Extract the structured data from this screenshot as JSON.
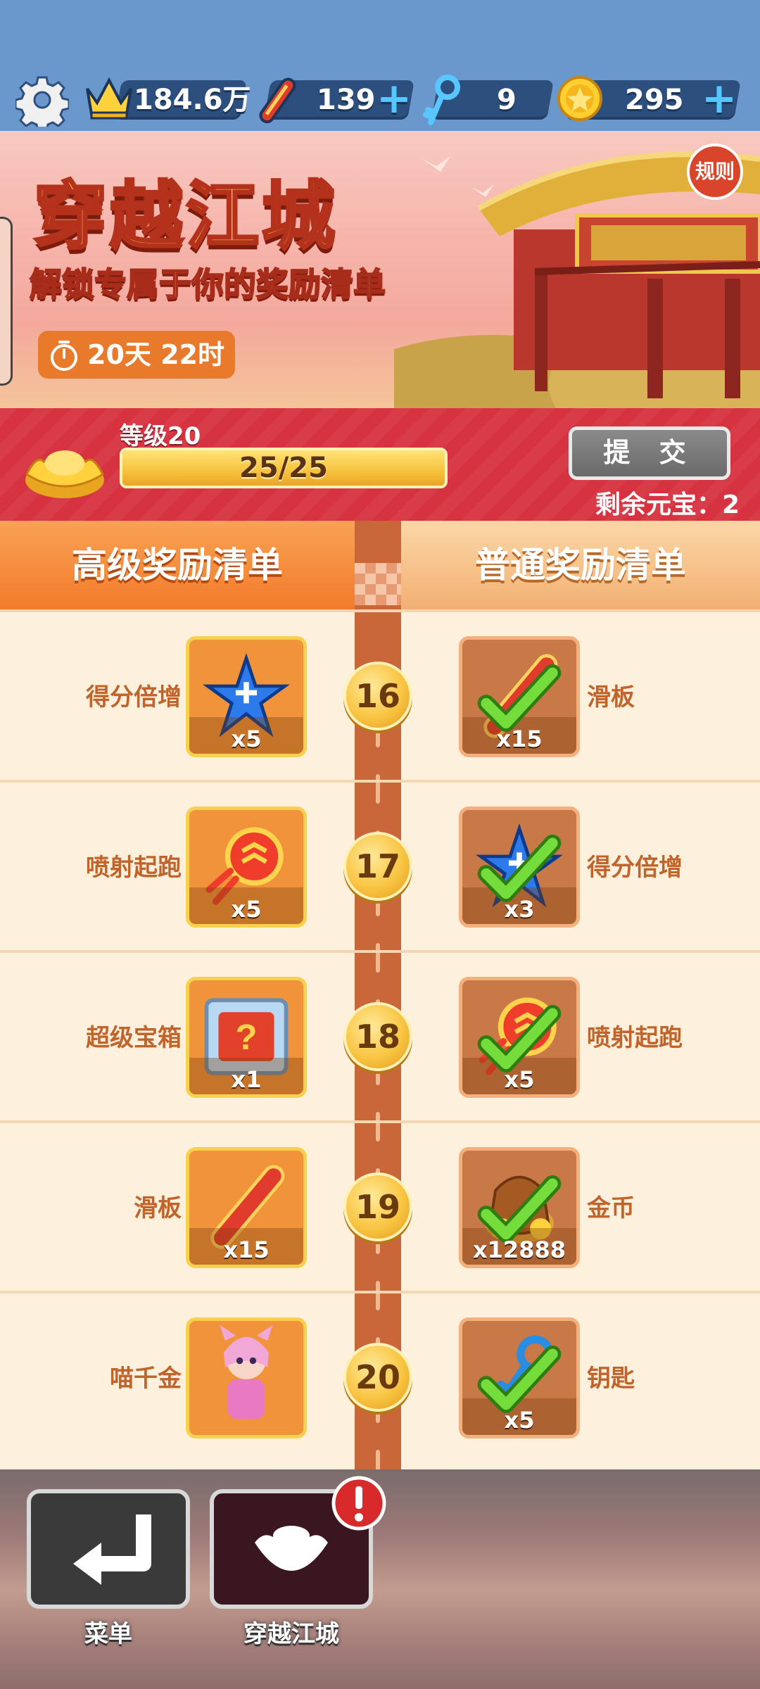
{
  "hud": {
    "crown_value": "184.6万",
    "boards_value": "139",
    "keys_value": "9",
    "coins_value": "295",
    "icons": [
      "gear-icon",
      "crown-icon",
      "hoverboard-icon",
      "key-icon",
      "coin-icon"
    ]
  },
  "banner": {
    "title": "穿越江城",
    "subtitle": "解锁专属于你的奖励清单",
    "timer": "20天 22时",
    "rules_label": "规则"
  },
  "level": {
    "label": "等级20",
    "progress_text": "25/25",
    "progress_fraction": 1.0,
    "submit_label": "提 交",
    "remaining": "剩余元宝：2"
  },
  "list": {
    "premium_header": "高级奖励清单",
    "normal_header": "普通奖励清单",
    "rows": [
      {
        "level": "16",
        "premium_label": "得分倍增",
        "premium_qty": "x5",
        "premium_icon": "score-multiplier-icon",
        "normal_label": "滑板",
        "normal_qty": "x15",
        "normal_icon": "hoverboard-icon",
        "normal_claimed": true
      },
      {
        "level": "17",
        "premium_label": "喷射起跑",
        "premium_qty": "x5",
        "premium_icon": "headstart-icon",
        "normal_label": "得分倍增",
        "normal_qty": "x3",
        "normal_icon": "score-multiplier-icon",
        "normal_claimed": true
      },
      {
        "level": "18",
        "premium_label": "超级宝箱",
        "premium_qty": "x1",
        "premium_icon": "mystery-box-icon",
        "normal_label": "喷射起跑",
        "normal_qty": "x5",
        "normal_icon": "headstart-icon",
        "normal_claimed": true
      },
      {
        "level": "19",
        "premium_label": "滑板",
        "premium_qty": "x15",
        "premium_icon": "hoverboard-icon",
        "normal_label": "金币",
        "normal_qty": "x12888",
        "normal_icon": "coin-bag-icon",
        "normal_claimed": true
      },
      {
        "level": "20",
        "premium_label": "喵千金",
        "premium_qty": "",
        "premium_icon": "character-icon",
        "normal_label": "钥匙",
        "normal_qty": "x5",
        "normal_icon": "key-icon",
        "normal_claimed": true
      }
    ]
  },
  "bottom": {
    "menu_label": "菜单",
    "city_label": "穿越江城"
  },
  "colors": {
    "sky": "#6b98cc",
    "level_bar": "#d6323f",
    "premium_header": "#f27b2a",
    "normal_header": "#f2b073",
    "road": "#c9663a",
    "check": "#6fd23a"
  }
}
